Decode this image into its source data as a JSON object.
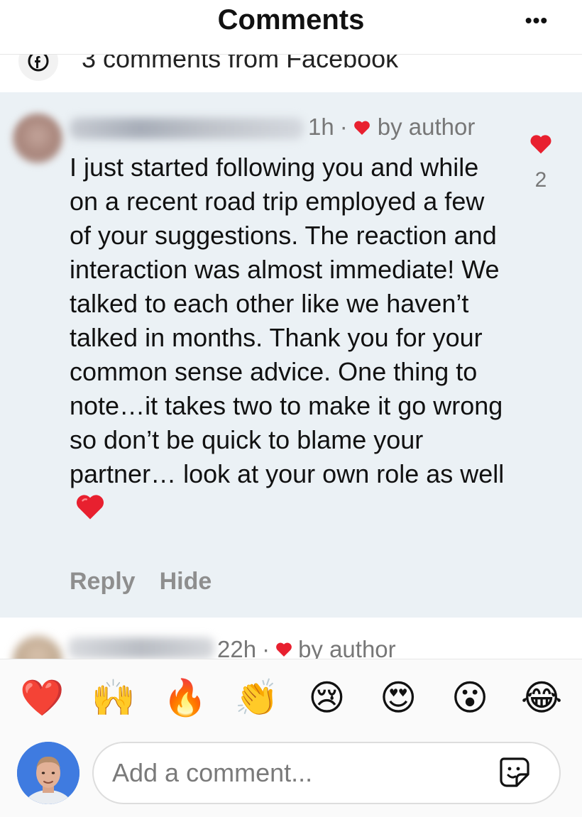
{
  "header": {
    "title": "Comments",
    "more_label": "•••"
  },
  "source": {
    "text": "3 comments from Facebook",
    "icon": "facebook-icon"
  },
  "comment": {
    "time": "1h",
    "dot": "·",
    "by_author": "by author",
    "like_count": "2",
    "text": "I just started following you and while on a recent road trip employed a few of your suggestions. The reaction and interaction was almost immediate! We talked to each other like we haven’t talked in months. Thank you for your common sense advice. One thing to note…it takes two to make it go wrong so don’t be quick to blame your partner… look at your own role as well",
    "reply_label": "Reply",
    "hide_label": "Hide",
    "heart_color": "#e8202f"
  },
  "next_comment": {
    "time": "22h",
    "dot": "·",
    "by_author": "by author"
  },
  "reactions": [
    "❤️",
    "🙌",
    "🔥",
    "👏",
    "😢",
    "😍",
    "😮",
    "😂"
  ],
  "composer": {
    "placeholder": "Add a comment...",
    "sticker_icon": "sticker-icon"
  }
}
